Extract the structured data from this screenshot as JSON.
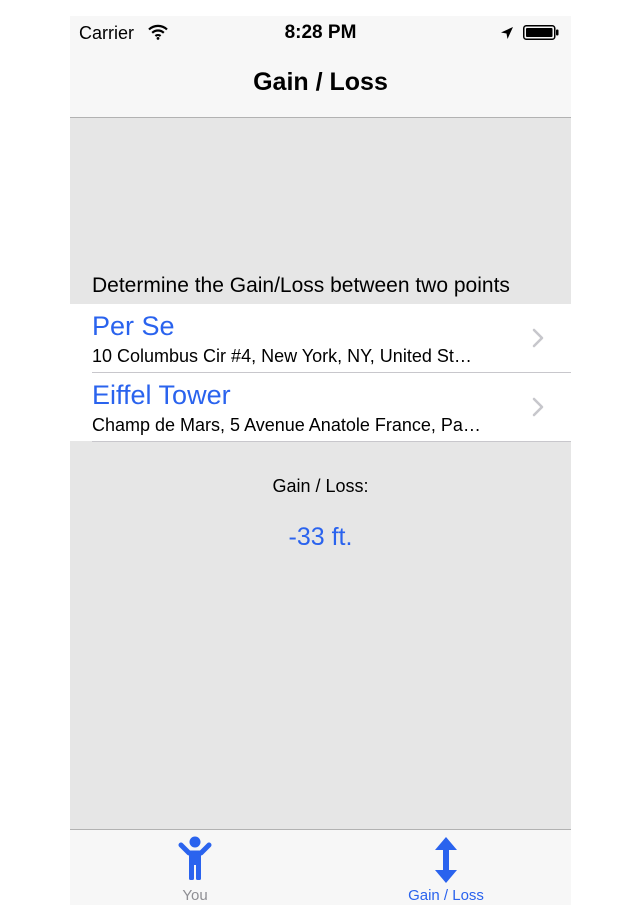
{
  "status_bar": {
    "carrier": "Carrier",
    "time": "8:28 PM"
  },
  "nav": {
    "title": "Gain / Loss"
  },
  "instruction": "Determine the Gain/Loss between two points",
  "points": [
    {
      "name": "Per Se",
      "address": "10 Columbus Cir #4, New York, NY, United St…"
    },
    {
      "name": "Eiffel Tower",
      "address": "Champ de Mars, 5 Avenue Anatole France, Pa…"
    }
  ],
  "result": {
    "label": "Gain / Loss:",
    "value": "-33 ft."
  },
  "tabs": [
    {
      "label": "You",
      "icon": "person-icon",
      "selected": false
    },
    {
      "label": "Gain / Loss",
      "icon": "vertical-arrows-icon",
      "selected": true
    }
  ],
  "colors": {
    "accent": "#2a63ee",
    "background": "#e6e6e6",
    "bar": "#f7f7f7",
    "inactive": "#8e8e93"
  }
}
